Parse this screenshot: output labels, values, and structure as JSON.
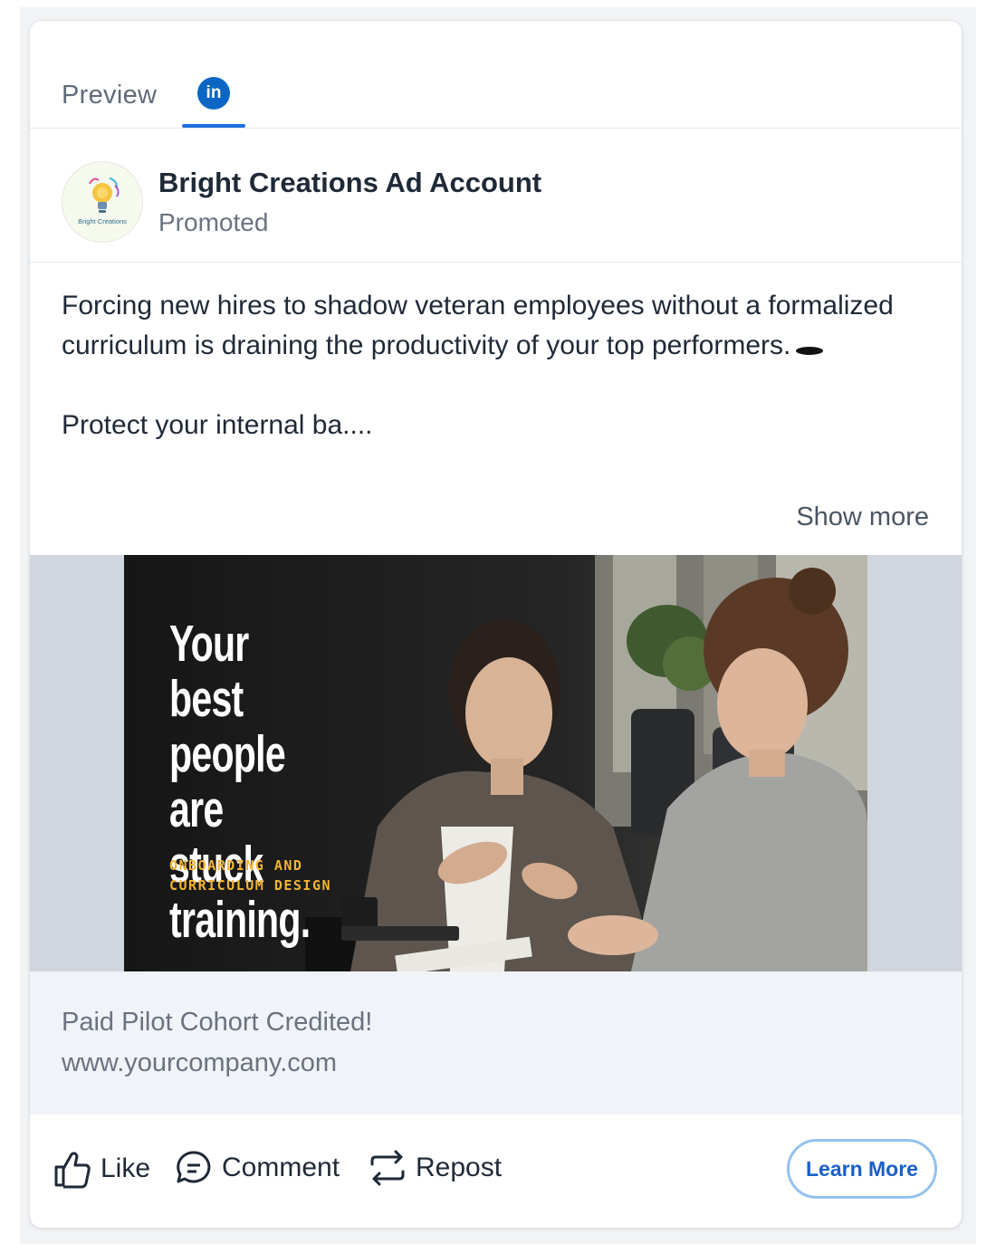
{
  "tabs": {
    "preview_label": "Preview",
    "network_icon": "linkedin-icon",
    "network_glyph": "in",
    "accent": "#1d6fe0",
    "linkedin_blue": "#0a66c2"
  },
  "post": {
    "account_name": "Bright Creations Ad Account",
    "sponsored_label": "Promoted",
    "avatar_text": "Bright Creations",
    "text_line_1": "Forcing new hires to shadow veteran employees without a formalized curriculum is draining the productivity of your top performers.",
    "text_line_2": "Protect your internal ba....",
    "show_more_label": "Show more"
  },
  "ad_image": {
    "headline": "Your best people are stuck training.",
    "subline_1": "ONBOARDING AND",
    "subline_2": "CURRICULUM DESIGN",
    "subline_color": "#f2b531"
  },
  "caption": {
    "title": "Paid Pilot Cohort Credited!",
    "url": "www.yourcompany.com"
  },
  "actions": {
    "like_label": "Like",
    "comment_label": "Comment",
    "repost_label": "Repost",
    "cta_label": "Learn More"
  }
}
